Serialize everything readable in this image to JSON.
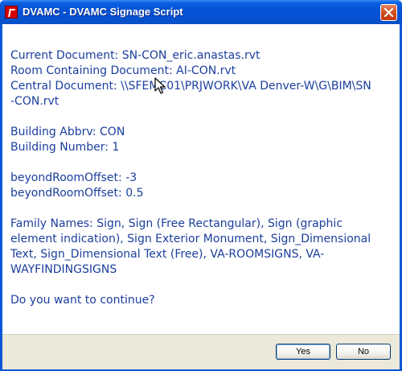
{
  "window": {
    "title": "DVAMC - DVAMC Signage Script"
  },
  "message": {
    "current_document": "Current Document: SN-CON_eric.anastas.rvt",
    "room_document": "Room Containing Document: AI-CON.rvt",
    "central_document": "Central Document: \\\\SFEMC01\\PRJWORK\\VA Denver-W\\G\\BIM\\SN-CON.rvt",
    "building_abbrv": "Building Abbrv: CON",
    "building_number": "Building Number: 1",
    "offset_1": "beyondRoomOffset: -3",
    "offset_2": "beyondRoomOffset: 0.5",
    "family_names": "Family Names: Sign, Sign (Free Rectangular), Sign (graphic element indication), Sign Exterior Monument, Sign_Dimensional Text, Sign_Dimensional Text (Free), VA-ROOMSIGNS, VA-WAYFINDINGSIGNS",
    "prompt": "Do you want to continue?"
  },
  "buttons": {
    "yes": "Yes",
    "no": "No"
  },
  "icons": {
    "app": "revit-app-icon",
    "close": "close-icon",
    "cursor": "mouse-cursor-icon"
  }
}
